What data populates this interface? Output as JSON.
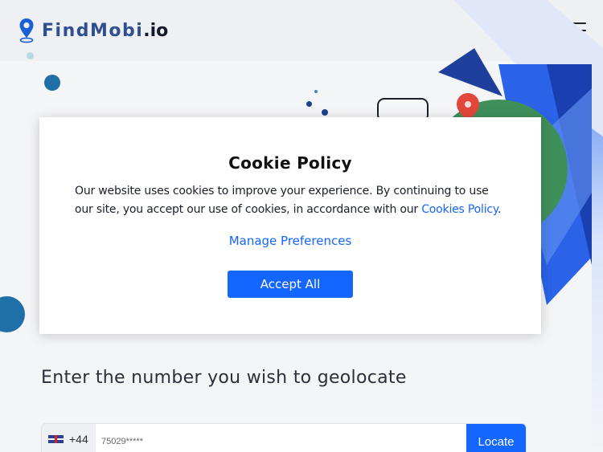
{
  "header": {
    "logo_main": "FindMobi",
    "logo_tld": ".io",
    "menu_icon": "hamburger-menu-icon"
  },
  "colors": {
    "accent": "#1366ff",
    "logo_blue": "#2f4f8f",
    "pin_blue": "#1b5fd8",
    "map_pin_red": "#e2473b",
    "globe_green": "#3f8f5a"
  },
  "main": {
    "prompt": "Enter the number you wish to geolocate",
    "country_code": "+44",
    "country_flag": "uk-flag-icon",
    "phone_value": "75029*****",
    "locate_label": "Locate"
  },
  "cookie_modal": {
    "title": "Cookie Policy",
    "body_text": "Our website uses cookies to improve your experience. By continuing to use our site, you accept our use of cookies, in accordance with our ",
    "policy_link": "Cookies Policy",
    "body_end": ".",
    "manage_label": "Manage Preferences",
    "accept_label": "Accept All"
  }
}
